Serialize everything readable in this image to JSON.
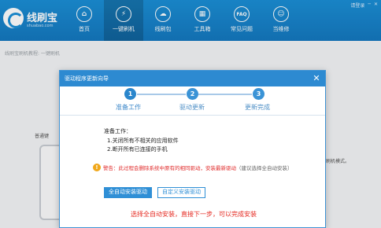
{
  "app": {
    "name": "线刷宝",
    "subtitle": "shuabao.com"
  },
  "window": {
    "login": "请登录",
    "minimize": "─",
    "close": "✕"
  },
  "nav": [
    {
      "label": "首页",
      "glyph": "⌂",
      "icon": "home-icon"
    },
    {
      "label": "一键刷机",
      "glyph": "⚡",
      "icon": "flash-icon"
    },
    {
      "label": "线刷包",
      "glyph": "☁",
      "icon": "cloud-icon"
    },
    {
      "label": "工具箱",
      "glyph": "▦",
      "icon": "toolbox-icon"
    },
    {
      "label": "常见问题",
      "glyph": "FAQ",
      "icon": "faq-icon"
    },
    {
      "label": "当维修",
      "glyph": "☺",
      "icon": "user-icon"
    }
  ],
  "background": {
    "breadcrumb": "线刷宝刷机教程: 一键刷机",
    "phone_label": "普通键",
    "right_text": "刷机模式。"
  },
  "dialog": {
    "title": "驱动程序更新向导",
    "close": "✕",
    "steps": [
      {
        "num": "1",
        "label": "准备工作"
      },
      {
        "num": "2",
        "label": "驱动更新"
      },
      {
        "num": "3",
        "label": "更新完成"
      }
    ],
    "prep_title": "准备工作：",
    "prep_items": [
      "1.关闭所有不相关的应用软件",
      "2.断开所有已连接的手机"
    ],
    "warning_key": "警告：",
    "warning_text": "此过程会删除系统中原有的相同驱动，安装最新驱动",
    "warning_note": "（建议选择全自动安装）",
    "btn_auto": "全自动安装驱动",
    "btn_custom": "自定义安装驱动",
    "hint": "选择全自动安装，直接下一步，可以完成安装"
  }
}
